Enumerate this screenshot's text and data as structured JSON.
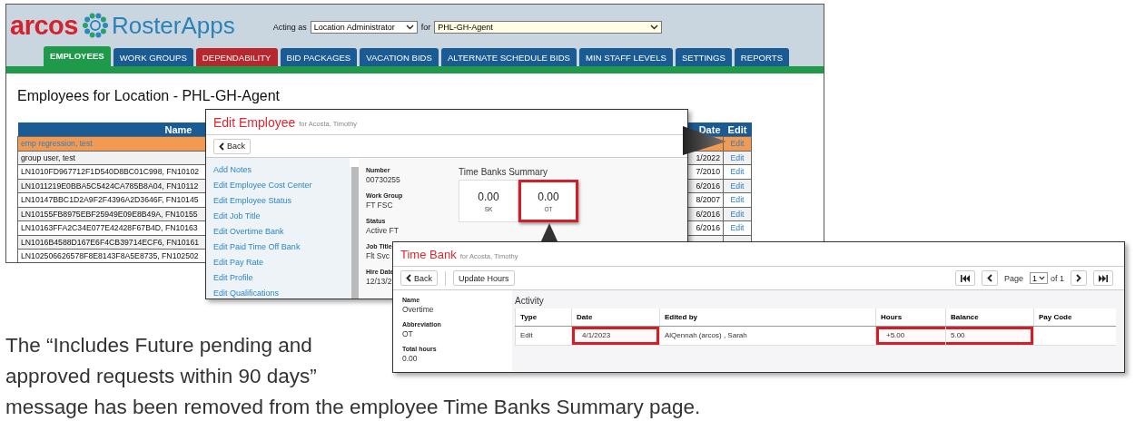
{
  "main_window": {
    "brand": "arcos",
    "product": "RosterApps",
    "acting_as_label": "Acting as",
    "role_select": "Location Administrator",
    "for_label": "for",
    "location_select": "PHL-GH-Agent",
    "tabs": [
      {
        "label": "EMPLOYEES",
        "selected": true,
        "color": "#1f9a4b"
      },
      {
        "label": "WORK GROUPS",
        "selected": false,
        "color": "#1b5b94"
      },
      {
        "label": "DEPENDABILITY",
        "selected": false,
        "color": "#b8262e"
      },
      {
        "label": "BID PACKAGES",
        "selected": false,
        "color": "#1b5b94"
      },
      {
        "label": "VACATION BIDS",
        "selected": false,
        "color": "#1b5b94"
      },
      {
        "label": "ALTERNATE SCHEDULE BIDS",
        "selected": false,
        "color": "#1b5b94"
      },
      {
        "label": "MIN STAFF LEVELS",
        "selected": false,
        "color": "#1b5b94"
      },
      {
        "label": "SETTINGS",
        "selected": false,
        "color": "#1b5b94"
      },
      {
        "label": "REPORTS",
        "selected": false,
        "color": "#1b5b94"
      }
    ],
    "heading": "Employees for Location - PHL-GH-Agent",
    "table": {
      "columns": [
        "Name",
        "Date",
        "Edit"
      ],
      "rows": [
        {
          "name": "emp regression, test",
          "edit": "Edit",
          "selected": true
        },
        {
          "name": "group user, test",
          "date": "1/2022",
          "edit": "Edit",
          "selected": false
        },
        {
          "name": "LN1010FD967712F1D540D8BC01C998, FN10102",
          "date": "7/2010",
          "edit": "Edit",
          "selected": false
        },
        {
          "name": "LN1011219E0BBA5C5424CA785B8A04, FN10112",
          "date": "6/2016",
          "edit": "Edit",
          "selected": false
        },
        {
          "name": "LN10147BBC1D2A9F2F4396A2D3646F, FN10145",
          "date": "8/2007",
          "edit": "Edit",
          "selected": false
        },
        {
          "name": "LN10155FB8975EBF25949E09E8B49A, FN10155",
          "date": "6/2016",
          "edit": "Edit",
          "selected": false
        },
        {
          "name": "LN10163FFA2C34E077E42428F67B4D, FN10163",
          "date": "6/2016",
          "edit": "Edit",
          "selected": false
        },
        {
          "name": "LN1016B4588D167E6F4CB39714ECF6, FN10161",
          "selected": false
        },
        {
          "name": "LN102506626578F8E8143F8A5E8735, FN102502",
          "selected": false
        }
      ]
    }
  },
  "edit_employee": {
    "title": "Edit Employee",
    "subtitle": "for Acosta, Timothy",
    "back": "Back",
    "nav": [
      "Add Notes",
      "Edit Employee Cost Center",
      "Edit Employee Status",
      "Edit Job Title",
      "Edit Overtime Bank",
      "Edit Paid Time Off Bank",
      "Edit Pay Rate",
      "Edit Profile",
      "Edit Qualifications"
    ],
    "details": [
      {
        "label": "Number",
        "value": "00730255"
      },
      {
        "label": "Work Group",
        "value": "FT FSC"
      },
      {
        "label": "Status",
        "value": "Active FT"
      },
      {
        "label": "Job Title",
        "value": "Flt Svc"
      },
      {
        "label": "Hire Date",
        "value": "12/13/2"
      }
    ],
    "summary_title": "Time Banks Summary",
    "banks": [
      {
        "value": "0.00",
        "code": "SK",
        "highlighted": false
      },
      {
        "value": "0.00",
        "code": "OT",
        "highlighted": true
      }
    ]
  },
  "time_bank": {
    "title": "Time Bank",
    "subtitle": "for Acosta, Timothy",
    "back": "Back",
    "update": "Update Hours",
    "pager": {
      "page_label": "Page",
      "page": "1",
      "of": "of 1"
    },
    "info": [
      {
        "label": "Name",
        "value": "Overtime"
      },
      {
        "label": "Abbreviation",
        "value": "OT"
      },
      {
        "label": "Total hours",
        "value": "0.00"
      }
    ],
    "activity_title": "Activity",
    "columns": [
      "Type",
      "Date",
      "Edited by",
      "Hours",
      "Balance",
      "Pay Code"
    ],
    "rows": [
      {
        "cells": [
          {
            "text": "Edit",
            "highlighted": false
          },
          {
            "text": "4/1/2023",
            "highlighted": true
          },
          {
            "text": "AlQennah (arcos) , Sarah",
            "highlighted": false
          },
          {
            "text": "+5.00",
            "highlighted": true
          },
          {
            "text": "5.00",
            "highlighted": true
          }
        ]
      }
    ]
  },
  "caption": [
    "The “Includes Future pending and approved requests within 90 days”",
    "message has been removed from the employee Time Banks Summary page."
  ]
}
